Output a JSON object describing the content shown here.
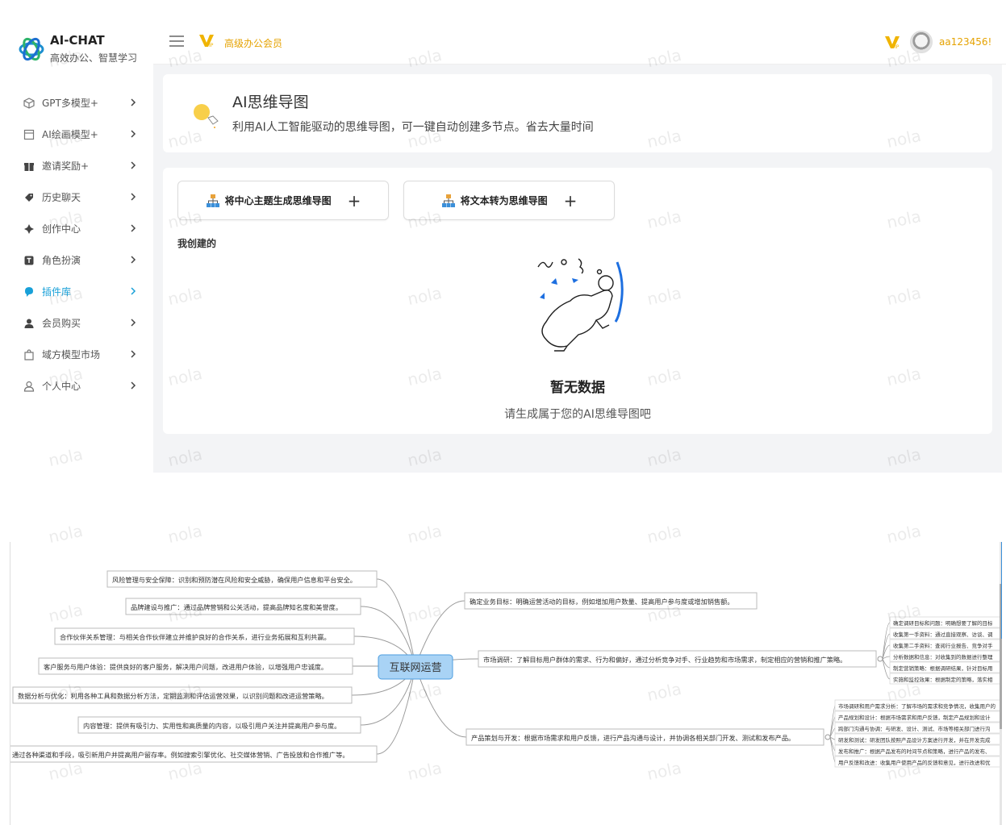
{
  "brand": {
    "title": "AI-CHAT",
    "subtitle": "高效办公、智慧学习"
  },
  "sidebar": {
    "items": [
      {
        "label": "GPT多模型+",
        "icon": "cube-icon"
      },
      {
        "label": "AI绘画模型+",
        "icon": "picture-frame-icon"
      },
      {
        "label": "邀请奖励+",
        "icon": "gift-icon"
      },
      {
        "label": "历史聊天",
        "icon": "tag-icon"
      },
      {
        "label": "创作中心",
        "icon": "sparkle-icon"
      },
      {
        "label": "角色扮演",
        "icon": "role-card-icon"
      },
      {
        "label": "插件库",
        "icon": "plugin-icon",
        "active": true
      },
      {
        "label": "会员购买",
        "icon": "member-icon"
      },
      {
        "label": "域方模型市场",
        "icon": "shop-bag-icon"
      },
      {
        "label": "个人中心",
        "icon": "user-icon"
      }
    ]
  },
  "header": {
    "vip_label": "高级办公会员",
    "username": "aa123456!"
  },
  "hero": {
    "title": "AI思维导图",
    "description": "利用AI人工智能驱动的思维导图，可一键自动创建多节点。省去大量时间"
  },
  "actions": {
    "topic_button": "将中心主题生成思维导图",
    "text_button": "将文本转为思维导图",
    "plus": "+"
  },
  "section": {
    "mine_label": "我创建的"
  },
  "empty": {
    "title": "暂无数据",
    "description": "请生成属于您的AI思维导图吧"
  },
  "watermark": "nola",
  "mindmap": {
    "center": "互联网运营",
    "left_nodes": [
      "风险管理与安全保障：识别和预防潜在风险和安全威胁，确保用户信息和平台安全。",
      "品牌建设与推广：通过品牌营销和公关活动，提高品牌知名度和美誉度。",
      "合作伙伴关系管理：与相关合作伙伴建立并维护良好的合作关系，进行业务拓展和互利共赢。",
      "客户服务与用户体验：提供良好的客户服务，解决用户问题，改进用户体验，以增强用户忠诚度。",
      "数据分析与优化：利用各种工具和数据分析方法，定期监测和评估运营效果，以识别问题和改进运营策略。",
      "内容管理：提供有吸引力、实用性和高质量的内容，以吸引用户关注并提高用户参与度。",
      "通过各种渠道和手段，吸引新用户并提高用户留存率。例如搜索引擎优化、社交媒体营销、广告投放和合作推广等。"
    ],
    "right_nodes": [
      "确定业务目标：明确运营活动的目标，例如增加用户数量、提高用户参与度或增加销售额。",
      "市场调研：了解目标用户群体的需求、行为和偏好，通过分析竞争对手、行业趋势和市场需求，制定相应的营销和推广策略。",
      "产品策划与开发：根据市场需求和用户反馈，进行产品沟通与设计，并协调各相关部门开发、测试和发布产品。"
    ],
    "market_sub": [
      "确定调研目标和问题：明确想要了解的目标",
      "收集第一手资料：通过直接观察、访谈、调",
      "收集第二手资料：查阅行业报告、竞争对手",
      "分析数据和信息：对收集到的数据进行整理",
      "制定营销策略：根据调研结果，针对目标用",
      "实施和监控效果：根据制定的策略，落实相"
    ],
    "product_sub": [
      "市场调研和用户需求分析：了解市场的需求和竞争情况，收集用户的",
      "产品规划和设计：根据市场需求和用户反馈，制定产品规划和设计",
      "跨部门沟通与协调：与研发、设计、测试、市场等相关部门进行沟",
      "研发和测试：研发团队按照产品设计方案进行开发，并在开发完成",
      "发布和推广：根据产品发布的时间节点和策略，进行产品的发布、",
      "用户反馈和改进：收集用户使用产品的反馈和意见，进行改进和优"
    ]
  },
  "colors": {
    "accent": "#18a0d8",
    "vip": "#e5a200",
    "center_node": "#a9d3f5",
    "center_border": "#4d9ee0"
  }
}
